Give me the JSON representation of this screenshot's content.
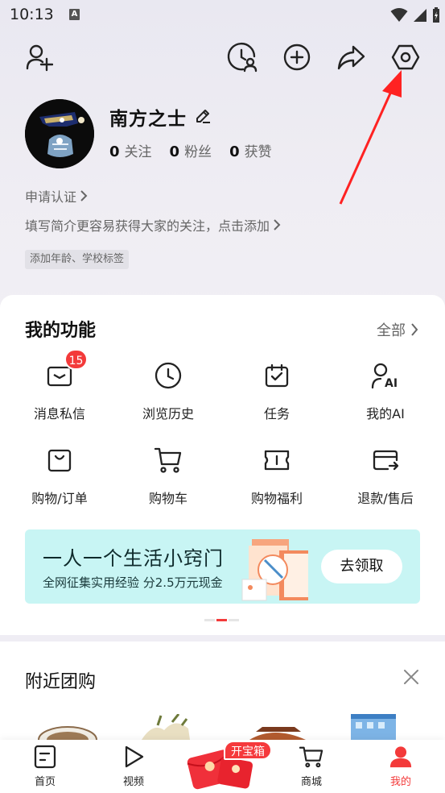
{
  "status_bar": {
    "time": "10:13",
    "notification_letter": "A"
  },
  "toolbar": {
    "add_friend_icon": "add-friend-icon",
    "visitor_icon": "visitor-history-icon",
    "create_icon": "plus-icon",
    "share_icon": "share-icon",
    "settings_icon": "settings-hexagon-icon"
  },
  "profile": {
    "username": "南方之士",
    "stats": [
      {
        "num": "0",
        "label": "关注"
      },
      {
        "num": "0",
        "label": "粉丝"
      },
      {
        "num": "0",
        "label": "获赞"
      }
    ],
    "verify_text": "申请认证",
    "bio_prompt": "填写简介更容易获得大家的关注，点击添加",
    "tag_prompt": "添加年龄、学校标签"
  },
  "functions": {
    "title": "我的功能",
    "all_label": "全部",
    "message_badge": "15",
    "items": [
      {
        "label": "消息私信",
        "icon": "message-icon"
      },
      {
        "label": "浏览历史",
        "icon": "clock-icon"
      },
      {
        "label": "任务",
        "icon": "calendar-task-icon"
      },
      {
        "label": "我的AI",
        "icon": "ai-user-icon"
      },
      {
        "label": "购物/订单",
        "icon": "shopping-bag-icon"
      },
      {
        "label": "购物车",
        "icon": "cart-icon"
      },
      {
        "label": "购物福利",
        "icon": "coupon-icon"
      },
      {
        "label": "退款/售后",
        "icon": "refund-card-icon"
      }
    ]
  },
  "banner": {
    "title": "一人一个生活小窍门",
    "subtitle": "全网征集实用经验 分2.5万元现金",
    "button": "去领取"
  },
  "nearby": {
    "title": "附近团购"
  },
  "bottom_nav": {
    "items": [
      {
        "label": "首页",
        "icon": "home-icon"
      },
      {
        "label": "视频",
        "icon": "play-icon"
      },
      {
        "label": "商城",
        "icon": "cart-icon"
      },
      {
        "label": "我的",
        "icon": "person-icon"
      }
    ],
    "treasure_tag": "开宝箱"
  },
  "colors": {
    "accent": "#f33a3a",
    "banner_bg": "#c8f5f4"
  }
}
